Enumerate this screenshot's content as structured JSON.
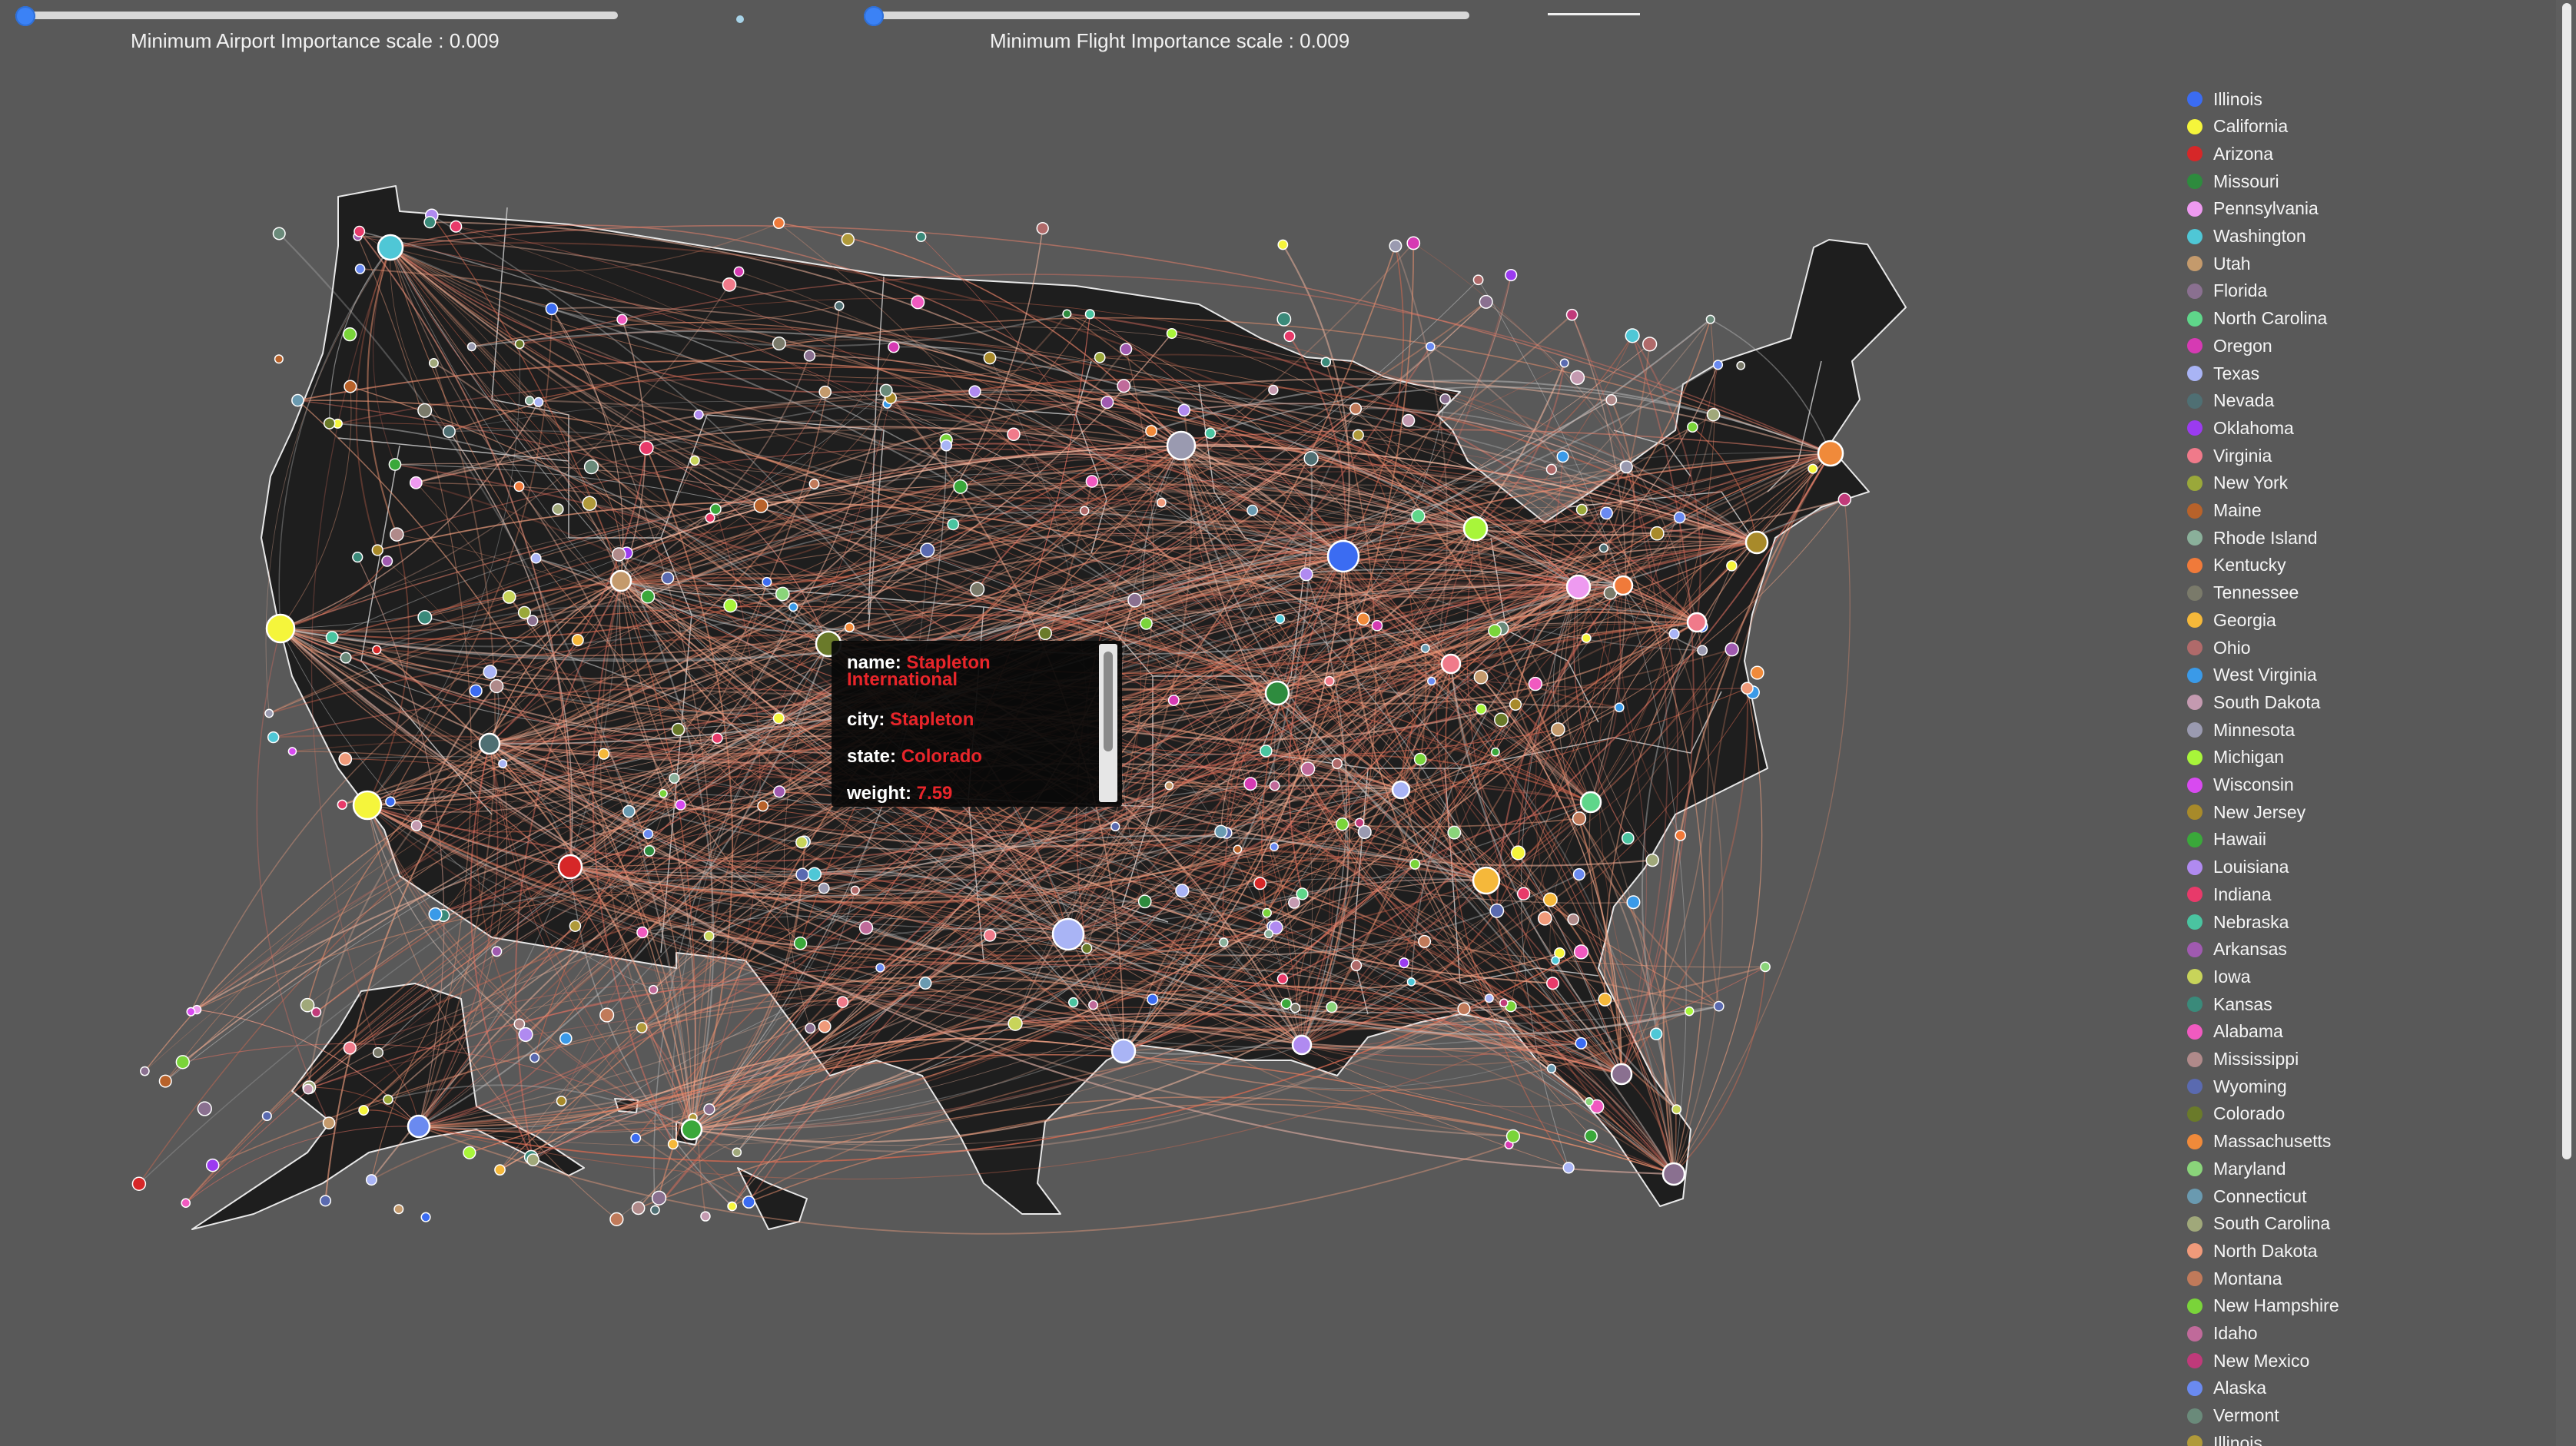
{
  "sliders": {
    "airport": {
      "label": "Minimum Airport Importance scale : 0.009",
      "value": 0.009
    },
    "flight": {
      "label": "Minimum Flight Importance scale : 0.009",
      "value": 0.009
    }
  },
  "tooltip": {
    "name_key": "name:",
    "name_val": "Stapleton International",
    "city_key": "city:",
    "city_val": "Stapleton",
    "state_key": "state:",
    "state_val": "Colorado",
    "weight_key": "weight:",
    "weight_val": "7.59"
  },
  "legend": [
    {
      "label": "Illinois",
      "color": "#3b6cf2"
    },
    {
      "label": "California",
      "color": "#f5f53b"
    },
    {
      "label": "Arizona",
      "color": "#d62728"
    },
    {
      "label": "Missouri",
      "color": "#2e8b3e"
    },
    {
      "label": "Pennsylvania",
      "color": "#ee9af0"
    },
    {
      "label": "Washington",
      "color": "#4fc7d6"
    },
    {
      "label": "Utah",
      "color": "#c49a6c"
    },
    {
      "label": "Florida",
      "color": "#8a7090"
    },
    {
      "label": "North Carolina",
      "color": "#5fd68a"
    },
    {
      "label": "Oregon",
      "color": "#d63ab3"
    },
    {
      "label": "Texas",
      "color": "#a9b4f5"
    },
    {
      "label": "Nevada",
      "color": "#4f6f73"
    },
    {
      "label": "Oklahoma",
      "color": "#9b3bf0"
    },
    {
      "label": "Virginia",
      "color": "#f07a8a"
    },
    {
      "label": "New York",
      "color": "#9aa83a"
    },
    {
      "label": "Maine",
      "color": "#b8622a"
    },
    {
      "label": "Rhode Island",
      "color": "#8ab09a"
    },
    {
      "label": "Kentucky",
      "color": "#f07a3a"
    },
    {
      "label": "Tennessee",
      "color": "#7a7a6a"
    },
    {
      "label": "Georgia",
      "color": "#f5b83a"
    },
    {
      "label": "Ohio",
      "color": "#b06a6a"
    },
    {
      "label": "West Virginia",
      "color": "#3a9ae8"
    },
    {
      "label": "South Dakota",
      "color": "#c49ab0"
    },
    {
      "label": "Minnesota",
      "color": "#9a9ab0"
    },
    {
      "label": "Michigan",
      "color": "#a8f53a"
    },
    {
      "label": "Wisconsin",
      "color": "#d84af0"
    },
    {
      "label": "New Jersey",
      "color": "#a88a2a"
    },
    {
      "label": "Hawaii",
      "color": "#3aa83a"
    },
    {
      "label": "Louisiana",
      "color": "#b08af0"
    },
    {
      "label": "Indiana",
      "color": "#e83a6a"
    },
    {
      "label": "Nebraska",
      "color": "#4ac4a0"
    },
    {
      "label": "Arkansas",
      "color": "#a05ab0"
    },
    {
      "label": "Iowa",
      "color": "#c8d45a"
    },
    {
      "label": "Kansas",
      "color": "#3a8a7a"
    },
    {
      "label": "Alabama",
      "color": "#f05ac0"
    },
    {
      "label": "Mississippi",
      "color": "#b08a8a"
    },
    {
      "label": "Wyoming",
      "color": "#5a6ab0"
    },
    {
      "label": "Colorado",
      "color": "#6a7a2a"
    },
    {
      "label": "Massachusetts",
      "color": "#f08a3a"
    },
    {
      "label": "Maryland",
      "color": "#8ad47a"
    },
    {
      "label": "Connecticut",
      "color": "#6a9ab0"
    },
    {
      "label": "South Carolina",
      "color": "#a0a87a"
    },
    {
      "label": "North Dakota",
      "color": "#f09a7a"
    },
    {
      "label": "Montana",
      "color": "#c07a5a"
    },
    {
      "label": "New Hampshire",
      "color": "#7ad43a"
    },
    {
      "label": "Idaho",
      "color": "#c06a9a"
    },
    {
      "label": "New Mexico",
      "color": "#c03a7a"
    },
    {
      "label": "Alaska",
      "color": "#6a8af0"
    },
    {
      "label": "Vermont",
      "color": "#6a8a7a"
    },
    {
      "label": "Illinois",
      "color": "#b09a3a"
    }
  ]
}
